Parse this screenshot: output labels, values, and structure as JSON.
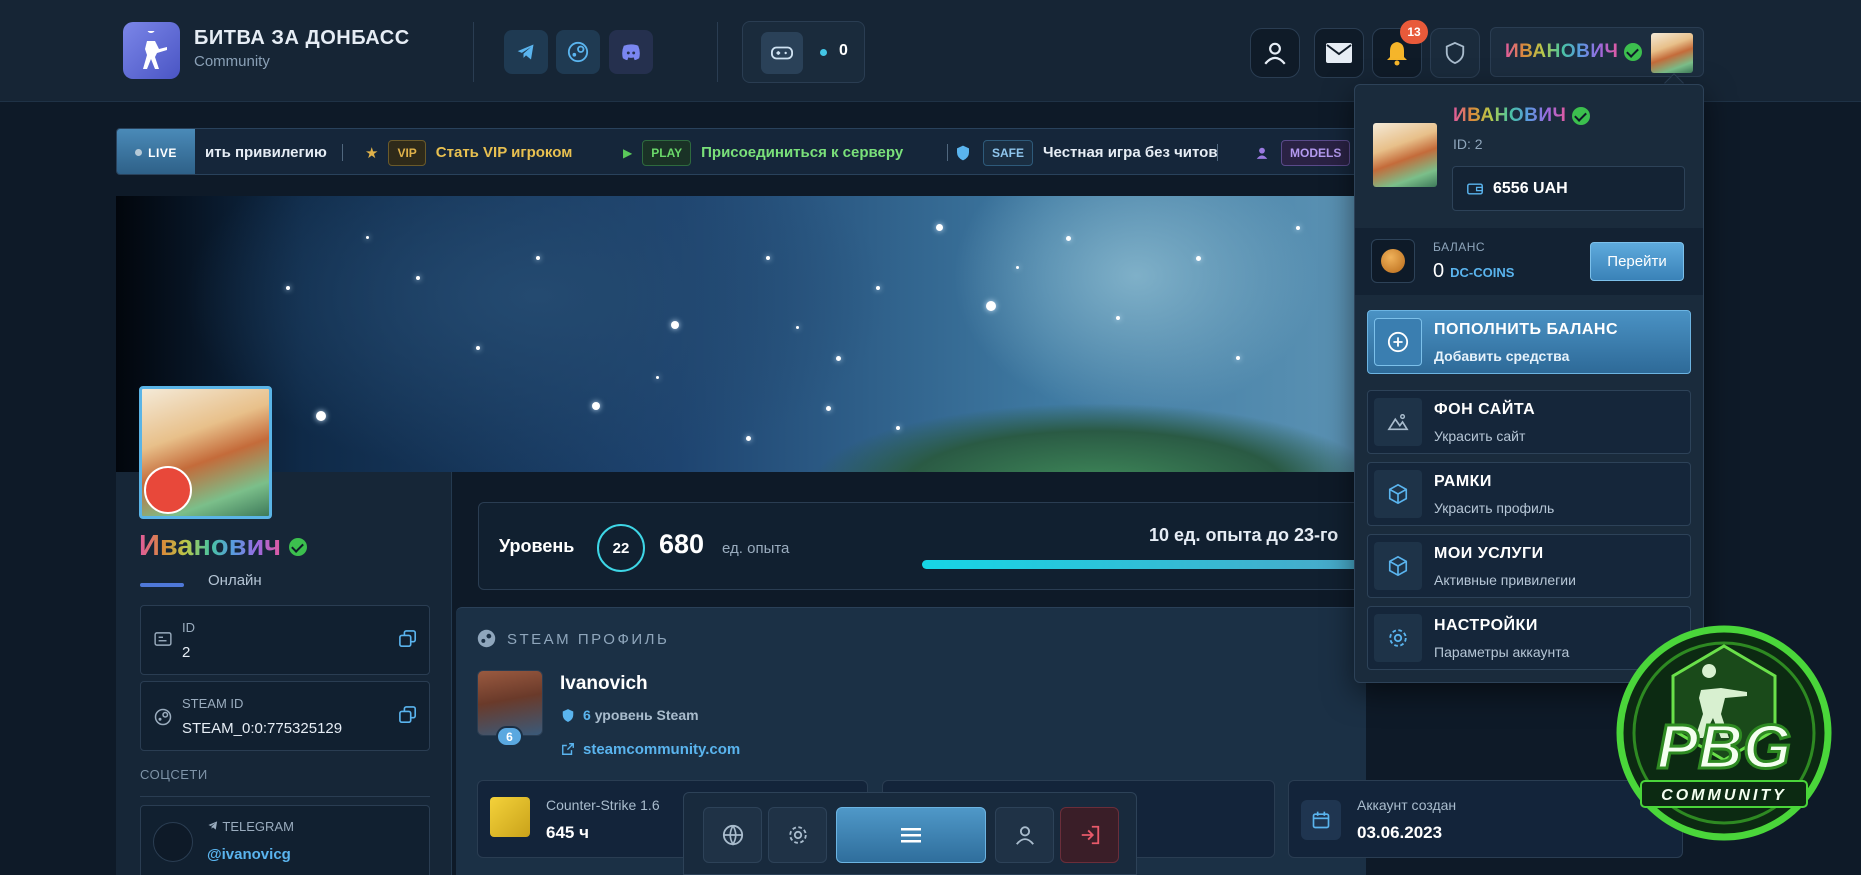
{
  "header": {
    "brand_title": "БИТВА ЗА ДОНБАСС",
    "brand_subtitle": "Community",
    "social": [
      "telegram-icon",
      "steam-icon",
      "discord-icon"
    ],
    "server_count": "0",
    "notifications_count": "13",
    "user_name": "ИВАНОВИЧ"
  },
  "ticker": {
    "live_label": "LIVE",
    "items": [
      {
        "tag": "",
        "text": "ить привилегию"
      },
      {
        "tag": "VIP",
        "text": "Стать VIP игроком"
      },
      {
        "tag": "PLAY",
        "text": "Присоединиться к серверу"
      },
      {
        "tag": "SAFE",
        "text": "Честная игра без читов"
      },
      {
        "tag": "MODELS",
        "text": ""
      }
    ]
  },
  "profile": {
    "name": "Иванович",
    "status": "Онлайн",
    "id_label": "ID",
    "id_value": "2",
    "steam_id_label": "STEAM ID",
    "steam_id_value": "STEAM_0:0:775325129",
    "socials_label": "СОЦСЕТИ",
    "telegram_label": "TELEGRAM",
    "telegram_handle": "@ivanovicg"
  },
  "level": {
    "label": "Уровень",
    "value": "22",
    "xp": "680",
    "xp_unit": "ед. опыта",
    "next": "10 ед. опыта до 23-го"
  },
  "steam": {
    "section_title": "STEAM ПРОФИЛЬ",
    "name": "Ivanovich",
    "level_badge": "6",
    "level_number": "6",
    "level_text": "уровень Steam",
    "link": "steamcommunity.com",
    "game_name": "Counter-Strike 1.6",
    "game_hours": "645 ч",
    "created_label": "Аккаунт создан",
    "created_date": "03.06.2023"
  },
  "dropdown": {
    "name": "ИВАНОВИЧ",
    "id": "ID: 2",
    "uah": "6556 UAH",
    "balance_label": "БАЛАНС",
    "balance_value": "0",
    "balance_coin": "DC-COINS",
    "go_label": "Перейти",
    "items": [
      {
        "title": "ПОПОЛНИТЬ БАЛАНС",
        "sub": "Добавить средства"
      },
      {
        "title": "ФОН САЙТА",
        "sub": "Украсить сайт"
      },
      {
        "title": "РАМКИ",
        "sub": "Украсить профиль"
      },
      {
        "title": "МОИ УСЛУГИ",
        "sub": "Активные привилегии"
      },
      {
        "title": "НАСТРОЙКИ",
        "sub": "Параметры аккаунта"
      }
    ]
  },
  "pbg": {
    "big": "PBG",
    "small": "COMMUNITY"
  },
  "colors": {
    "accent": "#5ab4ee",
    "verified": "#3cbf4e",
    "level_ring": "#3ed6e6",
    "notification": "#e85a3a"
  }
}
